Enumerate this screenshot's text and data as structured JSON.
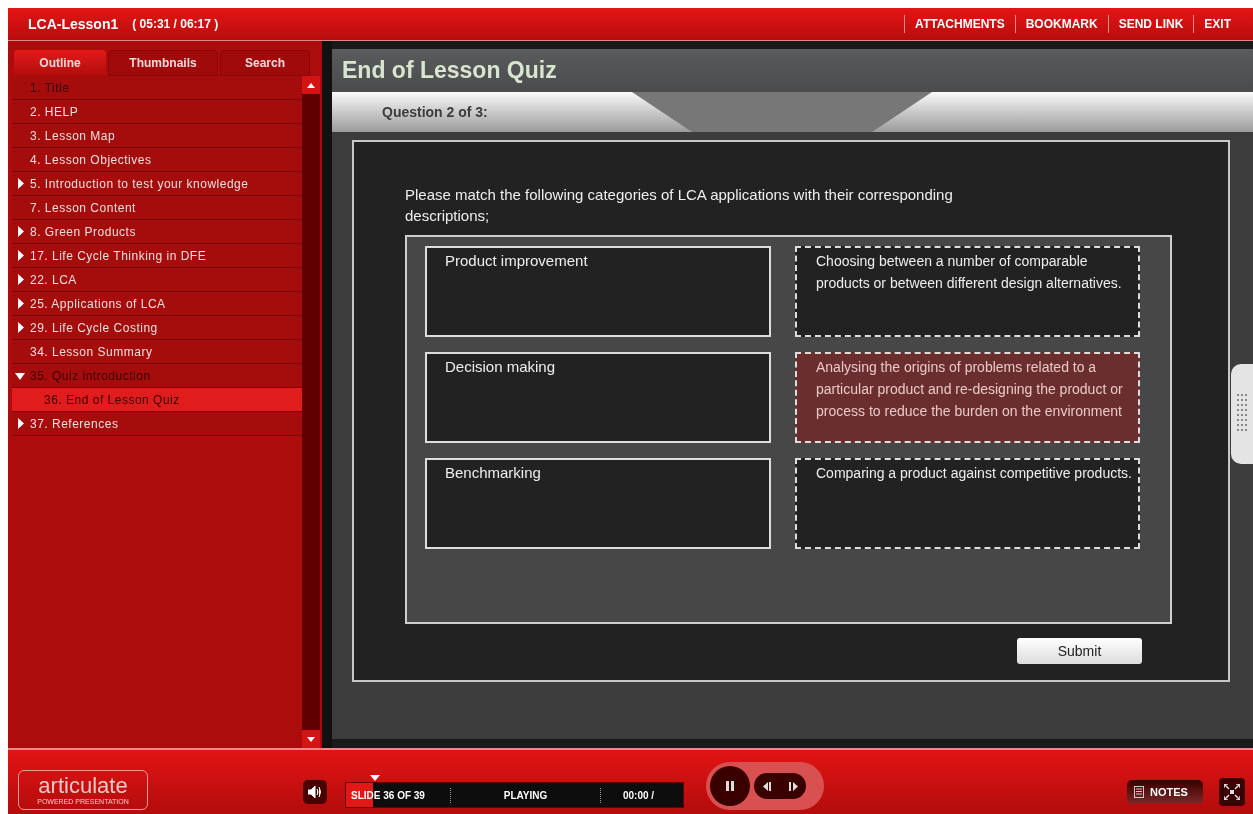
{
  "header": {
    "title": "LCA-Lesson1",
    "time": "( 05:31 / 06:17 )",
    "links": [
      "ATTACHMENTS",
      "BOOKMARK",
      "SEND LINK",
      "EXIT"
    ]
  },
  "sidebar": {
    "tabs": [
      {
        "label": "Outline",
        "selected": true
      },
      {
        "label": "Thumbnails",
        "selected": false
      },
      {
        "label": "Search",
        "selected": false
      }
    ],
    "items": [
      {
        "label": "1. Title",
        "kind": "leaf",
        "selected": false,
        "dim": true
      },
      {
        "label": "2. HELP",
        "kind": "leaf",
        "selected": false,
        "dim": false
      },
      {
        "label": "3. Lesson Map",
        "kind": "leaf",
        "selected": false,
        "dim": false
      },
      {
        "label": "4. Lesson Objectives",
        "kind": "leaf",
        "selected": false,
        "dim": false
      },
      {
        "label": "5. Introduction to test your knowledge",
        "kind": "group",
        "expanded": false,
        "selected": false,
        "dim": false
      },
      {
        "label": "7. Lesson Content",
        "kind": "leaf",
        "selected": false,
        "dim": false
      },
      {
        "label": "8. Green Products",
        "kind": "group",
        "expanded": false,
        "selected": false,
        "dim": false
      },
      {
        "label": "17. Life Cycle Thinking in DFE",
        "kind": "group",
        "expanded": false,
        "selected": false,
        "dim": false
      },
      {
        "label": "22. LCA",
        "kind": "group",
        "expanded": false,
        "selected": false,
        "dim": false
      },
      {
        "label": "25. Applications of LCA",
        "kind": "group",
        "expanded": false,
        "selected": false,
        "dim": false
      },
      {
        "label": "29. Life Cycle Costing",
        "kind": "group",
        "expanded": false,
        "selected": false,
        "dim": false
      },
      {
        "label": "34. Lesson Summary",
        "kind": "leaf",
        "selected": false,
        "dim": false
      },
      {
        "label": "35. Quiz introduction",
        "kind": "group",
        "expanded": true,
        "selected": false,
        "dim": true,
        "children": [
          {
            "label": "36. End of Lesson Quiz",
            "selected": true,
            "dim": true
          }
        ]
      },
      {
        "label": "37. References",
        "kind": "group",
        "expanded": false,
        "selected": false,
        "dim": false
      }
    ]
  },
  "slide": {
    "title": "End of Lesson Quiz",
    "question_label": "Question 2 of 3:",
    "prompt": "Please match the following categories of LCA applications with their corresponding descriptions;",
    "pairs": [
      {
        "category": "Product improvement",
        "description": "Choosing between a number of comparable products or between different design alternatives.",
        "selected": false
      },
      {
        "category": "Decision making",
        "description": "Analysing the origins of problems related to a particular product and re-designing the product or process to reduce the burden on the environment",
        "selected": true
      },
      {
        "category": "Benchmarking",
        "description": "Comparing a product against competitive products.",
        "selected": false
      }
    ],
    "submit": "Submit"
  },
  "player": {
    "logo": "articulate",
    "logo_sub": "POWERED PRESENTATION",
    "slide_counter": "SLIDE 36 OF 39",
    "status": "PLAYING",
    "elapsed": "00:00 /",
    "level": 0.08,
    "notes": "NOTES"
  }
}
